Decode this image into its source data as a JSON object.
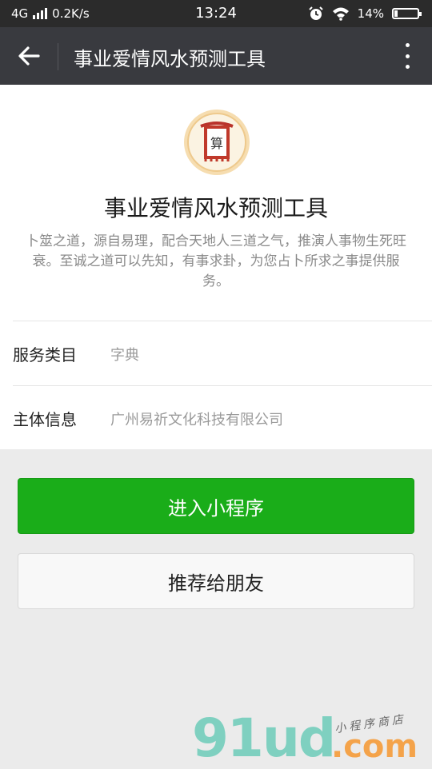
{
  "status_bar": {
    "network": "4G",
    "speed": "0.2K/s",
    "time": "13:24",
    "battery": "14%",
    "battery_level": 0.14,
    "icons": [
      "signal-icon",
      "alarm-icon",
      "wifi-icon",
      "battery-icon"
    ]
  },
  "nav": {
    "title": "事业爱情风水预测工具",
    "back_icon": "back-arrow-icon",
    "more_icon": "more-vertical-icon"
  },
  "app": {
    "name": "事业爱情风水预测工具",
    "logo_text": "算",
    "description": "卜筮之道，源自易理，配合天地人三道之气，推演人事物生死旺衰。至诚之道可以先知，有事求卦，为您占卜所求之事提供服务。"
  },
  "info": {
    "category_label": "服务类目",
    "category_value": "字典",
    "entity_label": "主体信息",
    "entity_value": "广州易祈文化科技有限公司"
  },
  "actions": {
    "enter_label": "进入小程序",
    "recommend_label": "推荐给朋友"
  },
  "watermark": {
    "main": "91ud",
    "suffix": ".com",
    "tagline": "小程序商店"
  },
  "colors": {
    "status_bar": "#2b2b2b",
    "title_bar": "#393a3f",
    "primary": "#1aad19",
    "background": "#ebebeb"
  }
}
